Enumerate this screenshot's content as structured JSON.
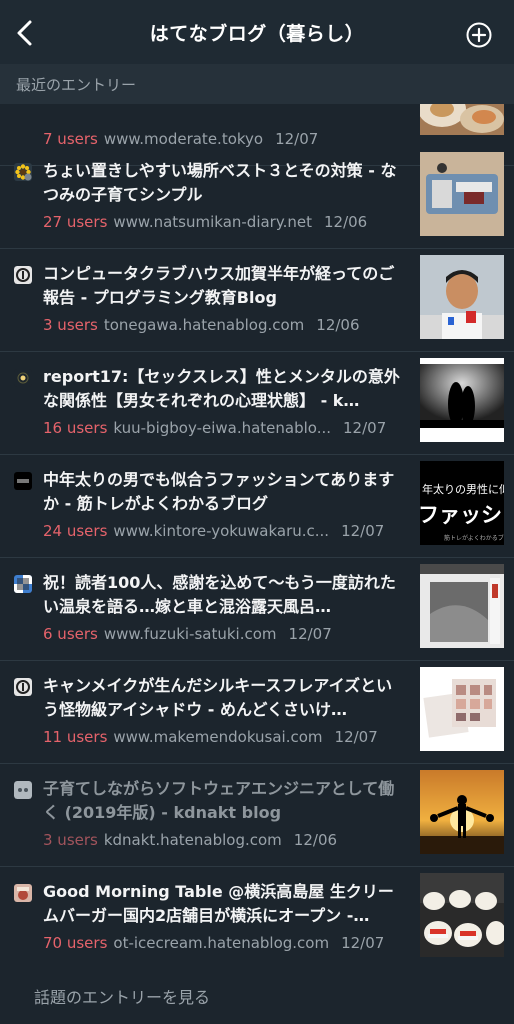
{
  "nav": {
    "title": "はてなブログ（暮らし）",
    "back_icon": "chevron-left-icon",
    "add_icon": "plus-circle-icon"
  },
  "section": {
    "header": "最近のエントリー"
  },
  "entries": [
    {
      "title": "",
      "users": "7 users",
      "domain": "www.moderate.tokyo",
      "date": "12/07",
      "read": false
    },
    {
      "title": "ちょい置きしやすい場所ベスト３とその対策 - なつみの子育てシンプル",
      "users": "27 users",
      "domain": "www.natsumikan-diary.net",
      "date": "12/06",
      "read": false
    },
    {
      "title": "コンピュータクラブハウス加賀半年が経ってのご報告 - プログラミング教育Blog",
      "users": "3 users",
      "domain": "tonegawa.hatenablog.com",
      "date": "12/06",
      "read": false
    },
    {
      "title": "report17:【セックスレス】性とメンタルの意外な関係性【男女それぞれの心理状態】 - k…",
      "users": "16 users",
      "domain": "kuu-bigboy-eiwa.hatenablo...",
      "date": "12/07",
      "read": false
    },
    {
      "title": "中年太りの男でも似合うファッションてありますか - 筋トレがよくわかるブログ",
      "users": "24 users",
      "domain": "www.kintore-yokuwakaru.c...",
      "date": "12/07",
      "read": false
    },
    {
      "title": "祝！読者100人、感謝を込めて〜もう一度訪れたい温泉を語る…嫁と車と混浴露天風呂…",
      "users": "6 users",
      "domain": "www.fuzuki-satuki.com",
      "date": "12/07",
      "read": false
    },
    {
      "title": "キャンメイクが生んだシルキースフレアイズという怪物級アイシャドウ - めんどくさいけ…",
      "users": "11 users",
      "domain": "www.makemendokusai.com",
      "date": "12/07",
      "read": false
    },
    {
      "title": "子育てしながらソフトウェアエンジニアとして働く (2019年版) - kdnakt blog",
      "users": "3 users",
      "domain": "kdnakt.hatenablog.com",
      "date": "12/06",
      "read": true
    },
    {
      "title": "Good Morning Table @横浜高島屋 生クリームバーガー国内2店舗目が横浜にオープン -…",
      "users": "70 users",
      "domain": "ot-icecream.hatenablog.com",
      "date": "12/07",
      "read": false
    }
  ],
  "thumb_text": {
    "fashion_line1": "年太りの男性に似合",
    "fashion_line2": "ファッション",
    "fashion_line3": "筋トレがよくわかるブ"
  },
  "footer": {
    "link": "話題のエントリーを見る"
  },
  "colors": {
    "background": "#1c252d",
    "navbar": "#1f2a33",
    "section_header": "#26313a",
    "users_accent": "#e5636b",
    "muted_text": "#9aa3aa"
  }
}
